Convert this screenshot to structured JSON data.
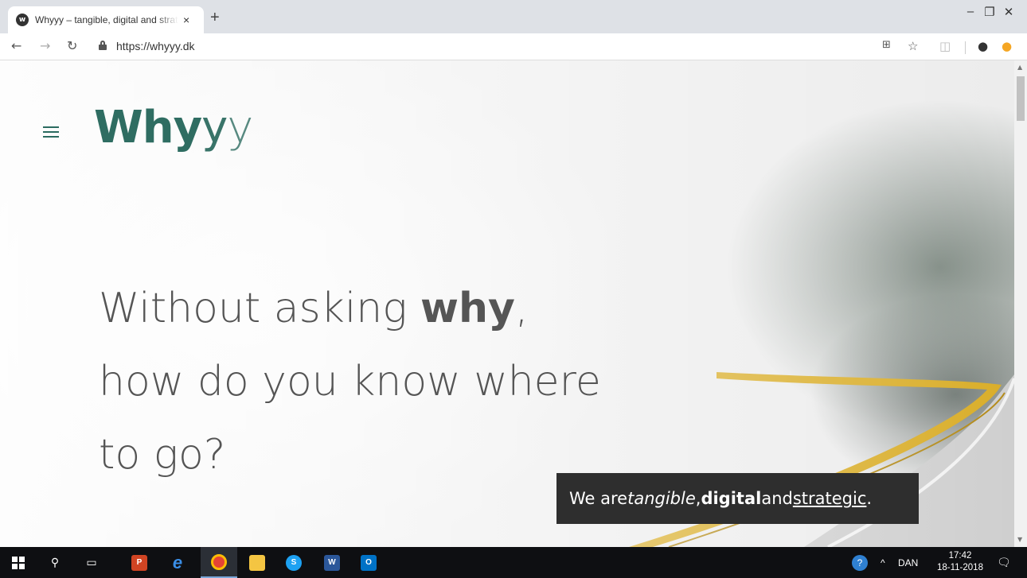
{
  "browser": {
    "tab_title": "Whyyy – tangible, digital and strategic",
    "tab_favicon_letter": "w",
    "tab_close": "×",
    "new_tab": "+",
    "url": "https://whyyy.dk",
    "window_controls": {
      "minimize": "–",
      "restore": "❐",
      "close": "✕"
    }
  },
  "page": {
    "logo": {
      "bold": "Why",
      "regular": "y",
      "light": "y"
    },
    "headline": {
      "line1_prefix": "Without asking ",
      "line1_strong": "why",
      "line1_suffix": ",",
      "line2": "how do you know where",
      "line3": "to go?"
    },
    "tagline": {
      "prefix": "We are ",
      "tangible": "tangible",
      "sep1": ", ",
      "digital": "digital",
      "sep2": " and ",
      "strategic": "strategic",
      "end": "."
    }
  },
  "taskbar": {
    "tray_language": "DAN",
    "time": "17:42",
    "date": "18-11-2018"
  },
  "colors": {
    "brand_green": "#2f6d62",
    "tagline_bg": "#2e2e2e",
    "road_rail": "#e0b42a"
  }
}
